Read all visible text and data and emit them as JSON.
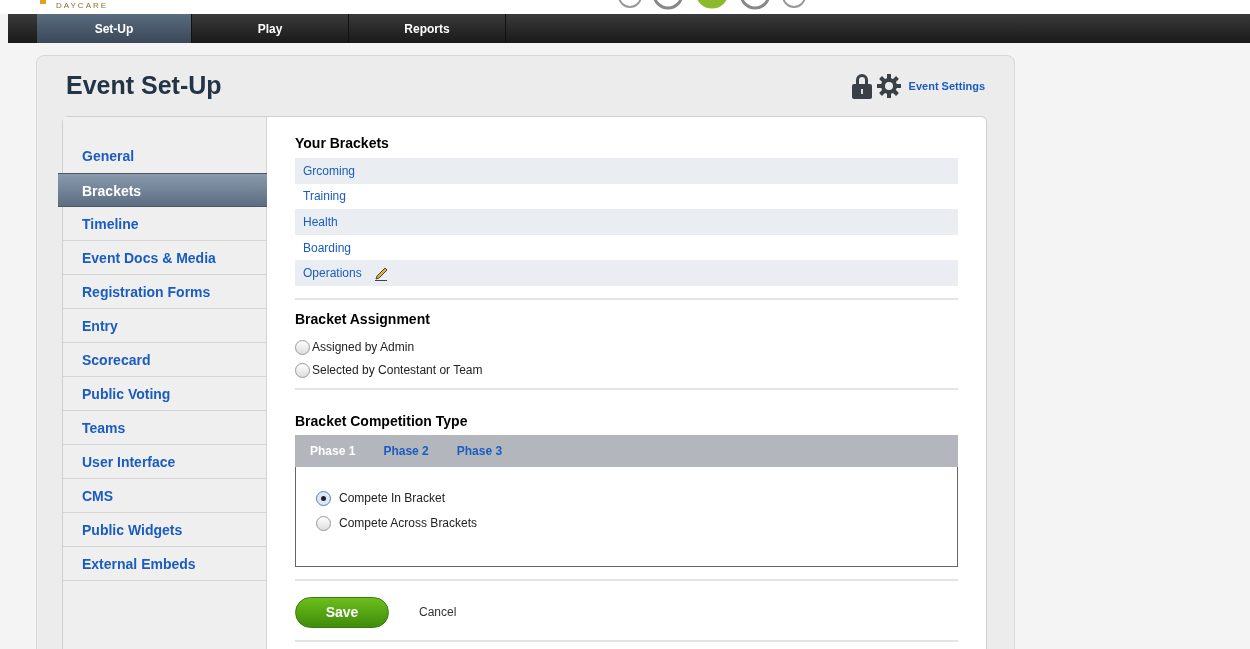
{
  "logo": {
    "text": "DAYCARE"
  },
  "nav_tabs": [
    {
      "label": "Set-Up",
      "selected": true
    },
    {
      "label": "Play",
      "selected": false
    },
    {
      "label": "Reports",
      "selected": false
    }
  ],
  "page_title": "Event Set-Up",
  "header_link": "Event Settings",
  "sidebar": {
    "items": [
      {
        "label": "General",
        "selected": false
      },
      {
        "label": "Brackets",
        "selected": true
      },
      {
        "label": "Timeline",
        "selected": false
      },
      {
        "label": "Event Docs & Media",
        "selected": false
      },
      {
        "label": "Registration Forms",
        "selected": false
      },
      {
        "label": "Entry",
        "selected": false
      },
      {
        "label": "Scorecard",
        "selected": false
      },
      {
        "label": "Public Voting",
        "selected": false
      },
      {
        "label": "Teams",
        "selected": false
      },
      {
        "label": "User Interface",
        "selected": false
      },
      {
        "label": "CMS",
        "selected": false
      },
      {
        "label": "Public Widgets",
        "selected": false
      },
      {
        "label": "External Embeds",
        "selected": false
      }
    ]
  },
  "your_brackets": {
    "title": "Your Brackets",
    "items": [
      {
        "label": "Grcoming",
        "editing": false
      },
      {
        "label": "Training",
        "editing": false
      },
      {
        "label": "Health",
        "editing": false
      },
      {
        "label": "Boarding",
        "editing": false
      },
      {
        "label": "Operations",
        "editing": true
      }
    ]
  },
  "bracket_assignment": {
    "title": "Bracket Assignment",
    "options": [
      {
        "label": "Assigned by Admin",
        "selected": false
      },
      {
        "label": "Selected by Contestant or Team",
        "selected": false
      }
    ]
  },
  "competition_type": {
    "title": "Bracket Competition Type",
    "tabs": [
      {
        "label": "Phase 1",
        "selected": true
      },
      {
        "label": "Phase 2",
        "selected": false
      },
      {
        "label": "Phase 3",
        "selected": false
      }
    ],
    "options": [
      {
        "label": "Compete In Bracket",
        "selected": true
      },
      {
        "label": "Compete Across Brackets",
        "selected": false
      }
    ]
  },
  "actions": {
    "save": "Save",
    "cancel": "Cancel"
  }
}
